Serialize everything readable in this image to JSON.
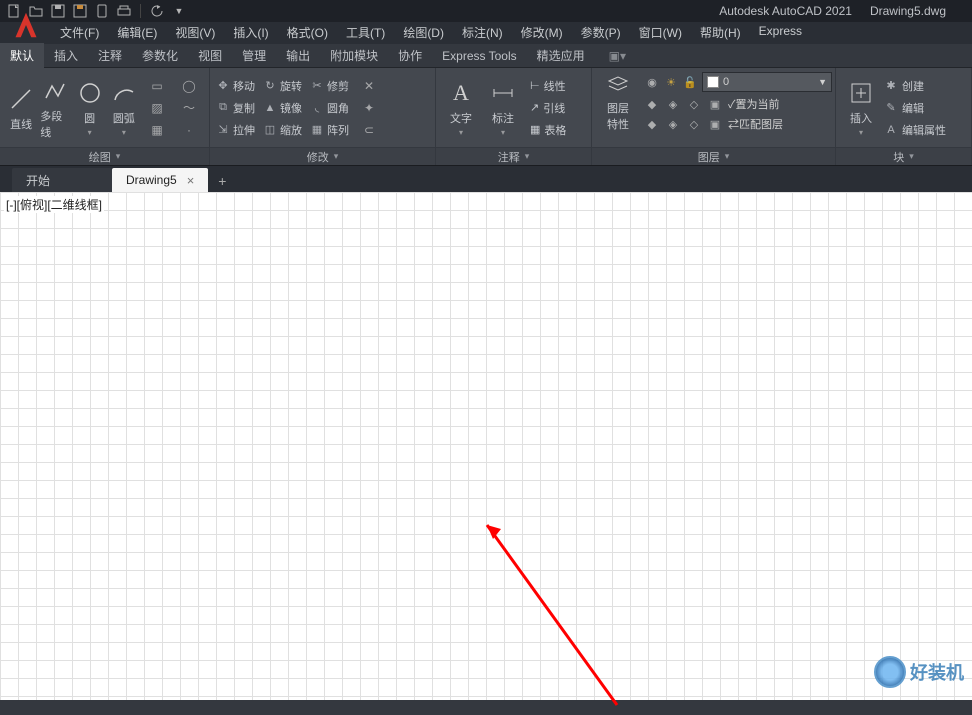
{
  "title": {
    "app": "Autodesk AutoCAD 2021",
    "file": "Drawing5.dwg"
  },
  "menu": {
    "file": "文件(F)",
    "edit": "编辑(E)",
    "view": "视图(V)",
    "insert": "插入(I)",
    "format": "格式(O)",
    "tools": "工具(T)",
    "draw": "绘图(D)",
    "dim": "标注(N)",
    "modify": "修改(M)",
    "param": "参数(P)",
    "window": "窗口(W)",
    "help": "帮助(H)",
    "express": "Express"
  },
  "ribtabs": {
    "default": "默认",
    "insert": "插入",
    "annotate": "注释",
    "param": "参数化",
    "view": "视图",
    "manage": "管理",
    "output": "输出",
    "addin": "附加模块",
    "collab": "协作",
    "etools": "Express Tools",
    "featured": "精选应用"
  },
  "panels": {
    "draw": {
      "title": "绘图",
      "line": "直线",
      "polyline": "多段线",
      "circle": "圆",
      "arc": "圆弧"
    },
    "modify": {
      "title": "修改",
      "move": "移动",
      "rotate": "旋转",
      "trim": "修剪",
      "copy": "复制",
      "mirror": "镜像",
      "fillet": "圆角",
      "stretch": "拉伸",
      "scale": "缩放",
      "array": "阵列"
    },
    "anno": {
      "title": "注释",
      "text": "文字",
      "dim": "标注",
      "linear": "线性",
      "leader": "引线",
      "table": "表格"
    },
    "layer": {
      "title": "图层",
      "props": "图层\n特性",
      "current": "0",
      "setcurrent": "置为当前",
      "match": "匹配图层"
    },
    "block": {
      "title": "块",
      "insert": "插入",
      "create": "创建",
      "edit": "编辑",
      "editattr": "编辑属性"
    }
  },
  "doctabs": {
    "home": "开始",
    "active": "Drawing5"
  },
  "canvas": {
    "viewlabel": "[-][俯视][二维线框]"
  },
  "watermark": "好装机"
}
